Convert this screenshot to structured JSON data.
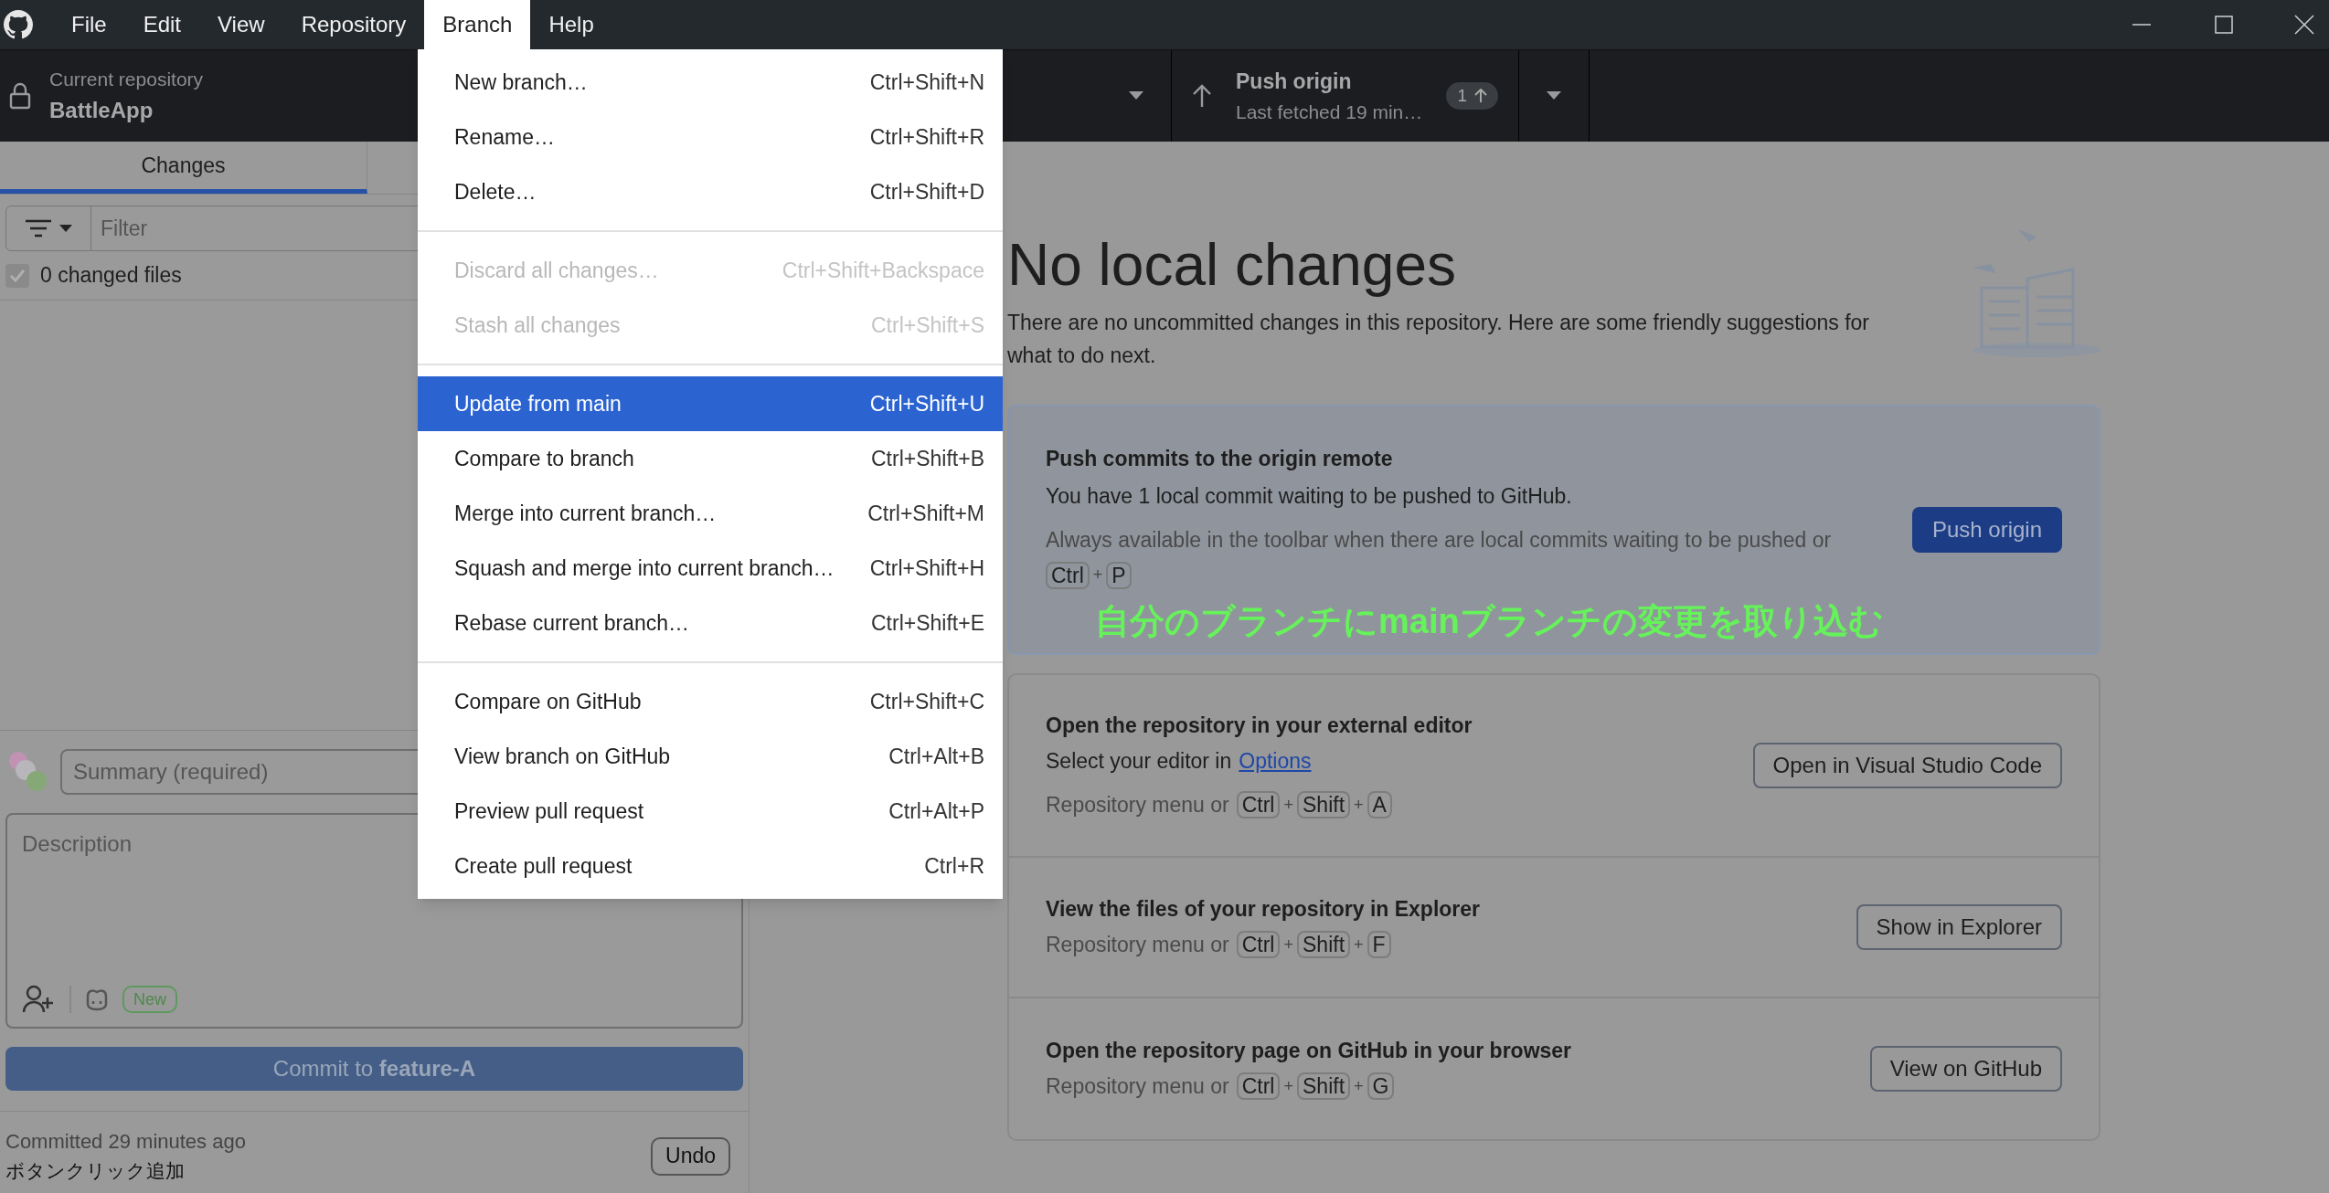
{
  "menubar": [
    {
      "label": "File",
      "selected": false
    },
    {
      "label": "Edit",
      "selected": false
    },
    {
      "label": "View",
      "selected": false
    },
    {
      "label": "Repository",
      "selected": false
    },
    {
      "label": "Branch",
      "selected": true
    },
    {
      "label": "Help",
      "selected": false
    }
  ],
  "toolbar": {
    "repository": {
      "label": "Current repository",
      "name": "BattleApp"
    },
    "push": {
      "title": "Push origin",
      "subtitle": "Last fetched 19 min…",
      "badge": "1"
    }
  },
  "sidebar": {
    "tabs": [
      {
        "label": "Changes",
        "selected": true
      }
    ],
    "filter": {
      "placeholder": "Filter"
    },
    "changed_files": {
      "label": "0 changed files",
      "checked": true
    },
    "summary": {
      "placeholder": "Summary (required)"
    },
    "description": {
      "placeholder": "Description"
    },
    "new_badge": "New",
    "commit_button": "Commit to **feature-A**",
    "last_commit": {
      "time": "Committed 29 minutes ago",
      "message": "ボタンクリック追加",
      "undo": "Undo"
    }
  },
  "branch_menu": [
    {
      "kind": "item",
      "label": "New branch…",
      "shortcut": "Ctrl+Shift+N",
      "disabled": false,
      "selected": false
    },
    {
      "kind": "item",
      "label": "Rename…",
      "shortcut": "Ctrl+Shift+R",
      "disabled": false,
      "selected": false
    },
    {
      "kind": "item",
      "label": "Delete…",
      "shortcut": "Ctrl+Shift+D",
      "disabled": false,
      "selected": false
    },
    {
      "kind": "separator"
    },
    {
      "kind": "item",
      "label": "Discard all changes…",
      "shortcut": "Ctrl+Shift+Backspace",
      "disabled": true,
      "selected": false
    },
    {
      "kind": "item",
      "label": "Stash all changes",
      "shortcut": "Ctrl+Shift+S",
      "disabled": true,
      "selected": false
    },
    {
      "kind": "separator"
    },
    {
      "kind": "item",
      "label": "Update from main",
      "shortcut": "Ctrl+Shift+U",
      "disabled": false,
      "selected": true
    },
    {
      "kind": "item",
      "label": "Compare to branch",
      "shortcut": "Ctrl+Shift+B",
      "disabled": false,
      "selected": false
    },
    {
      "kind": "item",
      "label": "Merge into current branch…",
      "shortcut": "Ctrl+Shift+M",
      "disabled": false,
      "selected": false
    },
    {
      "kind": "item",
      "label": "Squash and merge into current branch…",
      "shortcut": "Ctrl+Shift+H",
      "disabled": false,
      "selected": false
    },
    {
      "kind": "item",
      "label": "Rebase current branch…",
      "shortcut": "Ctrl+Shift+E",
      "disabled": false,
      "selected": false
    },
    {
      "kind": "separator"
    },
    {
      "kind": "item",
      "label": "Compare on GitHub",
      "shortcut": "Ctrl+Shift+C",
      "disabled": false,
      "selected": false
    },
    {
      "kind": "item",
      "label": "View branch on GitHub",
      "shortcut": "Ctrl+Alt+B",
      "disabled": false,
      "selected": false
    },
    {
      "kind": "item",
      "label": "Preview pull request",
      "shortcut": "Ctrl+Alt+P",
      "disabled": false,
      "selected": false
    },
    {
      "kind": "item",
      "label": "Create pull request",
      "shortcut": "Ctrl+R",
      "disabled": false,
      "selected": false
    }
  ],
  "main": {
    "title": "No local changes",
    "intro": "There are no uncommitted changes in this repository. Here are some friendly suggestions for what to do next.",
    "push_card": {
      "title": "Push commits to the origin remote",
      "text": "You have 1 local commit waiting to be pushed to GitHub.",
      "hint": "Always available in the toolbar when there are local commits waiting to be pushed or",
      "shortcut": [
        {
          "kind": "key",
          "text": "Ctrl"
        },
        {
          "kind": "plus",
          "text": "+"
        },
        {
          "kind": "key",
          "text": "P"
        }
      ],
      "button": "Push origin"
    },
    "actions": [
      {
        "title": "Open the repository in your external editor",
        "text": "Select your editor in",
        "link": "Options",
        "lead": "Repository menu or",
        "shortcut": [
          {
            "kind": "key",
            "text": "Ctrl"
          },
          {
            "kind": "plus",
            "text": "+"
          },
          {
            "kind": "key",
            "text": "Shift"
          },
          {
            "kind": "plus",
            "text": "+"
          },
          {
            "kind": "key",
            "text": "A"
          }
        ],
        "button": "Open in Visual Studio Code"
      },
      {
        "title": "View the files of your repository in Explorer",
        "lead": "Repository menu or",
        "shortcut": [
          {
            "kind": "key",
            "text": "Ctrl"
          },
          {
            "kind": "plus",
            "text": "+"
          },
          {
            "kind": "key",
            "text": "Shift"
          },
          {
            "kind": "plus",
            "text": "+"
          },
          {
            "kind": "key",
            "text": "F"
          }
        ],
        "button": "Show in Explorer"
      },
      {
        "title": "Open the repository page on GitHub in your browser",
        "lead": "Repository menu or",
        "shortcut": [
          {
            "kind": "key",
            "text": "Ctrl"
          },
          {
            "kind": "plus",
            "text": "+"
          },
          {
            "kind": "key",
            "text": "Shift"
          },
          {
            "kind": "plus",
            "text": "+"
          },
          {
            "kind": "key",
            "text": "G"
          }
        ],
        "button": "View on GitHub"
      }
    ]
  },
  "annotation": "自分のブランチにmainブランチの変更を取り込む"
}
